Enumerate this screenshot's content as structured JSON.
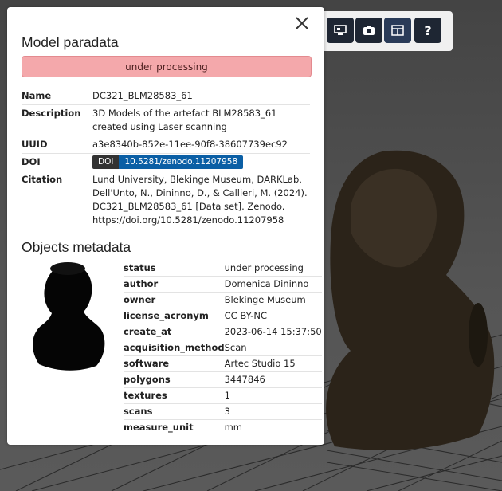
{
  "panel": {
    "model_title": "Model paradata",
    "status_banner": "under processing",
    "paradata": [
      {
        "key": "Name",
        "value": "DC321_BLM28583_61"
      },
      {
        "key": "Description",
        "value": "3D Models of the artefact BLM28583_61 created using Laser scanning"
      },
      {
        "key": "UUID",
        "value": "a3e8340b-852e-11ee-90f8-38607739ec92"
      },
      {
        "key": "DOI",
        "badge_label": "DOI",
        "badge_value": "10.5281/zenodo.11207958"
      },
      {
        "key": "Citation",
        "value": "Lund University, Blekinge Museum, DARKLab, Dell'Unto, N., Dininno, D., & Callieri, M. (2024). DC321_BLM28583_61 [Data set]. Zenodo. https://doi.org/10.5281/zenodo.11207958"
      }
    ],
    "objects_title": "Objects metadata",
    "objects": [
      {
        "key": "status",
        "value": "under processing"
      },
      {
        "key": "author",
        "value": "Domenica Dininno"
      },
      {
        "key": "owner",
        "value": "Blekinge Museum"
      },
      {
        "key": "license_acronym",
        "value": "CC BY-NC"
      },
      {
        "key": "create_at",
        "value": "2023-06-14 15:37:50"
      },
      {
        "key": "acquisition_method",
        "value": "Scan"
      },
      {
        "key": "software",
        "value": "Artec Studio 15"
      },
      {
        "key": "polygons",
        "value": "3447846"
      },
      {
        "key": "textures",
        "value": "1"
      },
      {
        "key": "scans",
        "value": "3"
      },
      {
        "key": "measure_unit",
        "value": "mm"
      }
    ]
  },
  "toolbar": {
    "buttons": [
      {
        "icon": "screen-icon"
      },
      {
        "icon": "camera-icon"
      },
      {
        "icon": "panel-icon"
      },
      {
        "icon": "help-icon",
        "label": "?"
      }
    ]
  },
  "colors": {
    "banner_bg": "#f4a8ab",
    "toolbar_btn": "#1e2633",
    "doi_blue": "#0b5fa5"
  }
}
